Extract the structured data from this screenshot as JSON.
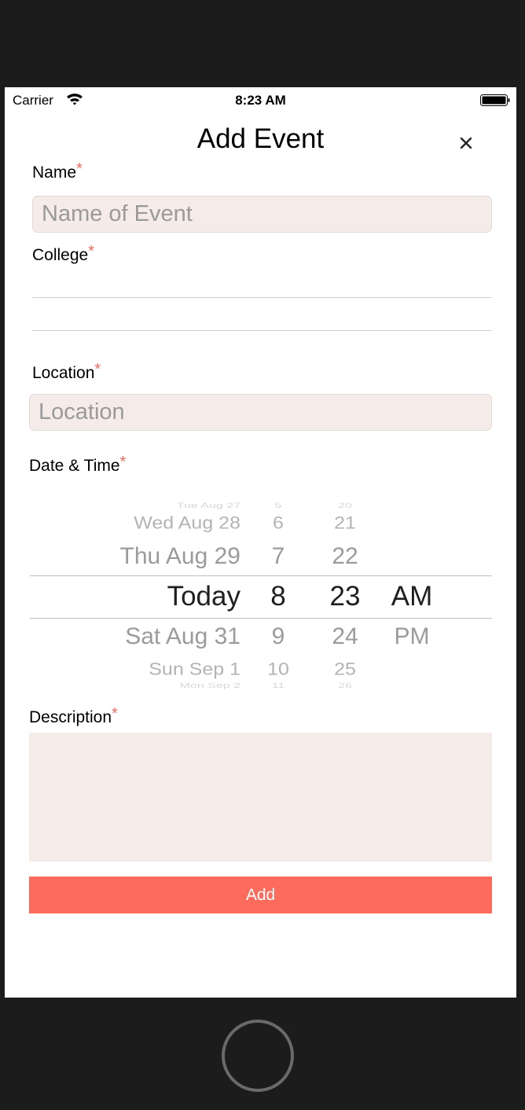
{
  "status_bar": {
    "carrier": "Carrier",
    "time": "8:23 AM"
  },
  "header": {
    "title": "Add Event"
  },
  "form": {
    "required_mark": "*",
    "name": {
      "label": "Name",
      "placeholder": "Name of Event",
      "value": ""
    },
    "college": {
      "label": "College"
    },
    "location": {
      "label": "Location",
      "placeholder": "Location",
      "value": ""
    },
    "datetime": {
      "label": "Date & Time",
      "dates": [
        "Tue Aug 27",
        "Wed Aug 28",
        "Thu Aug 29",
        "Today",
        "Sat Aug 31",
        "Sun Sep 1",
        "Mon Sep 2"
      ],
      "hours": [
        "5",
        "6",
        "7",
        "8",
        "9",
        "10",
        "11"
      ],
      "minutes": [
        "20",
        "21",
        "22",
        "23",
        "24",
        "25",
        "26"
      ],
      "ampm": [
        "AM",
        "PM"
      ]
    },
    "description": {
      "label": "Description",
      "value": ""
    },
    "add_label": "Add"
  },
  "colors": {
    "accent": "#fd6b5d",
    "input_bg": "#f5ebe9",
    "required": "#f06a5d"
  },
  "icons": [
    "wifi-icon",
    "battery-icon",
    "close-icon"
  ]
}
